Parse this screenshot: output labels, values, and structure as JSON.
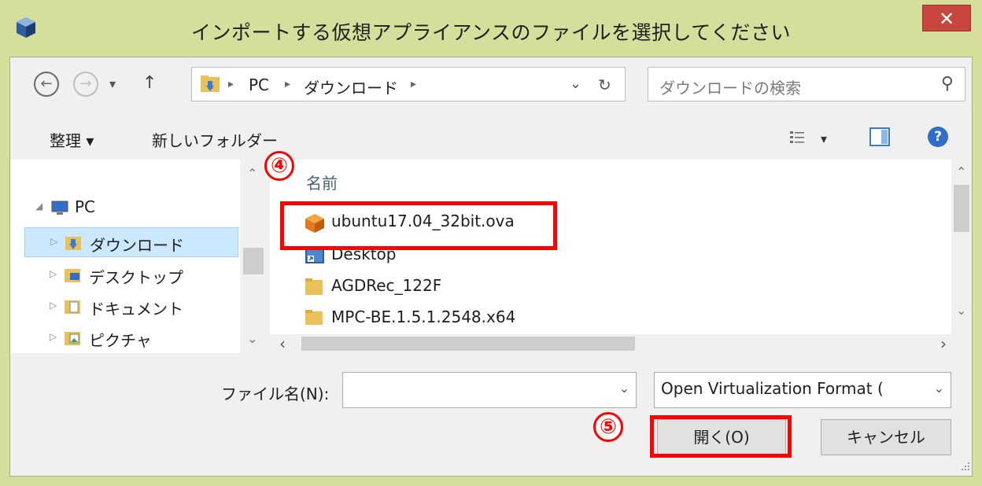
{
  "window": {
    "title": "インポートする仮想アプライアンスのファイルを選択してください",
    "close_glyph": "✕"
  },
  "address": {
    "back_glyph": "←",
    "forward_glyph": "→",
    "recent_glyph": "▾",
    "up_glyph": "↑",
    "crumb_sep": "▸",
    "crumbs": [
      "PC",
      "ダウンロード"
    ],
    "history_glyph": "⌄",
    "refresh_glyph": "↻"
  },
  "search": {
    "placeholder": "ダウンロードの検索",
    "icon_glyph": "⚲"
  },
  "toolbar": {
    "organize_label": "整理 ▾",
    "new_folder_label": "新しいフォルダー",
    "view_dropdown_glyph": "▾",
    "help_glyph": "?"
  },
  "nav_tree": {
    "root": {
      "label": "PC",
      "expand_glyph": "◢"
    },
    "items": [
      {
        "label": "ダウンロード",
        "selected": true
      },
      {
        "label": "デスクトップ",
        "selected": false
      },
      {
        "label": "ドキュメント",
        "selected": false
      },
      {
        "label": "ピクチャ",
        "selected": false
      }
    ],
    "collapse_glyph": "▷",
    "scroll_up_glyph": "⌃",
    "scroll_down_glyph": "⌄"
  },
  "file_list": {
    "column_name": "名前",
    "files": [
      {
        "name": "ubuntu17.04_32bit.ova",
        "icon": "ova-package-icon"
      },
      {
        "name": "Desktop",
        "icon": "desktop-shortcut-icon"
      },
      {
        "name": "AGDRec_122F",
        "icon": "folder-icon"
      },
      {
        "name": "MPC-BE.1.5.1.2548.x64",
        "icon": "folder-icon"
      }
    ],
    "scroll_up_glyph": "⌃",
    "scroll_down_glyph": "⌄",
    "scroll_left_glyph": "‹",
    "scroll_right_glyph": "›"
  },
  "bottom": {
    "filename_label": "ファイル名(N):",
    "filename_value": "",
    "filename_dropdown_glyph": "⌄",
    "filetype_value": "Open Virtualization Format (",
    "filetype_dropdown_glyph": "⌄",
    "open_label": "開く(O)",
    "cancel_label": "キャンセル"
  },
  "annotations": {
    "step4": "④",
    "step5": "⑤",
    "color": "#ff0000"
  }
}
